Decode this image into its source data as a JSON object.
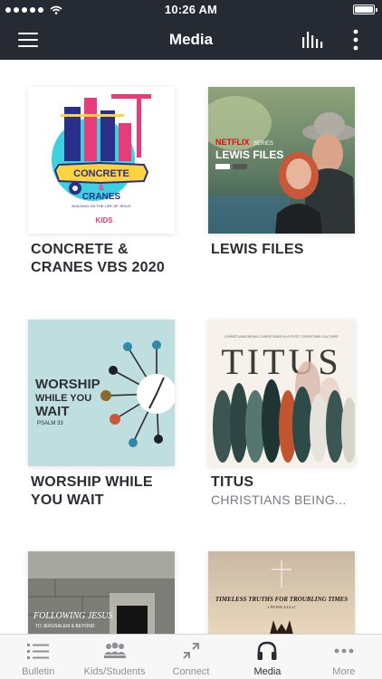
{
  "status_bar": {
    "time": "10:26 AM"
  },
  "header": {
    "title": "Media"
  },
  "grid": {
    "items": [
      {
        "title": "CONCRETE & CRANES VBS 2020",
        "subtitle": "",
        "art_text": [
          "CONCRETE",
          "&",
          "CRANES"
        ],
        "art_caption": "BUILDING ON THE LIFE OF JESUS",
        "art_brand": "KIDS"
      },
      {
        "title": "LEWIS FILES",
        "subtitle": "",
        "art_text": [
          "NETFLIX",
          "SERIES",
          "LEWIS FILES"
        ]
      },
      {
        "title": "WORSHIP WHILE YOU WAIT",
        "subtitle": "",
        "art_text": [
          "WORSHIP",
          "WHILE YOU",
          "WAIT",
          "PSALM 33"
        ]
      },
      {
        "title": "TITUS",
        "subtitle": "CHRISTIANS BEING...",
        "art_text": [
          "CHRISTIANS BEING CHRISTIANS IN A POST CHRISTIAN CULTURE",
          "TITUS"
        ]
      },
      {
        "title": "",
        "subtitle": "",
        "art_text": [
          "FOLLOWING JESUS",
          "TO JERUSALEM & BEYOND"
        ]
      },
      {
        "title": "",
        "subtitle": "",
        "art_text": [
          "TIMELESS TRUTHS FOR TROUBLING TIMES",
          "1 PETER 3:13-17"
        ]
      }
    ]
  },
  "nav": {
    "items": [
      {
        "label": "Bulletin",
        "icon": "list-icon"
      },
      {
        "label": "Kids/Students",
        "icon": "group-icon"
      },
      {
        "label": "Connect",
        "icon": "arrows-icon"
      },
      {
        "label": "Media",
        "icon": "headphones-icon"
      },
      {
        "label": "More",
        "icon": "ellipsis-icon"
      }
    ],
    "active": "Media"
  }
}
